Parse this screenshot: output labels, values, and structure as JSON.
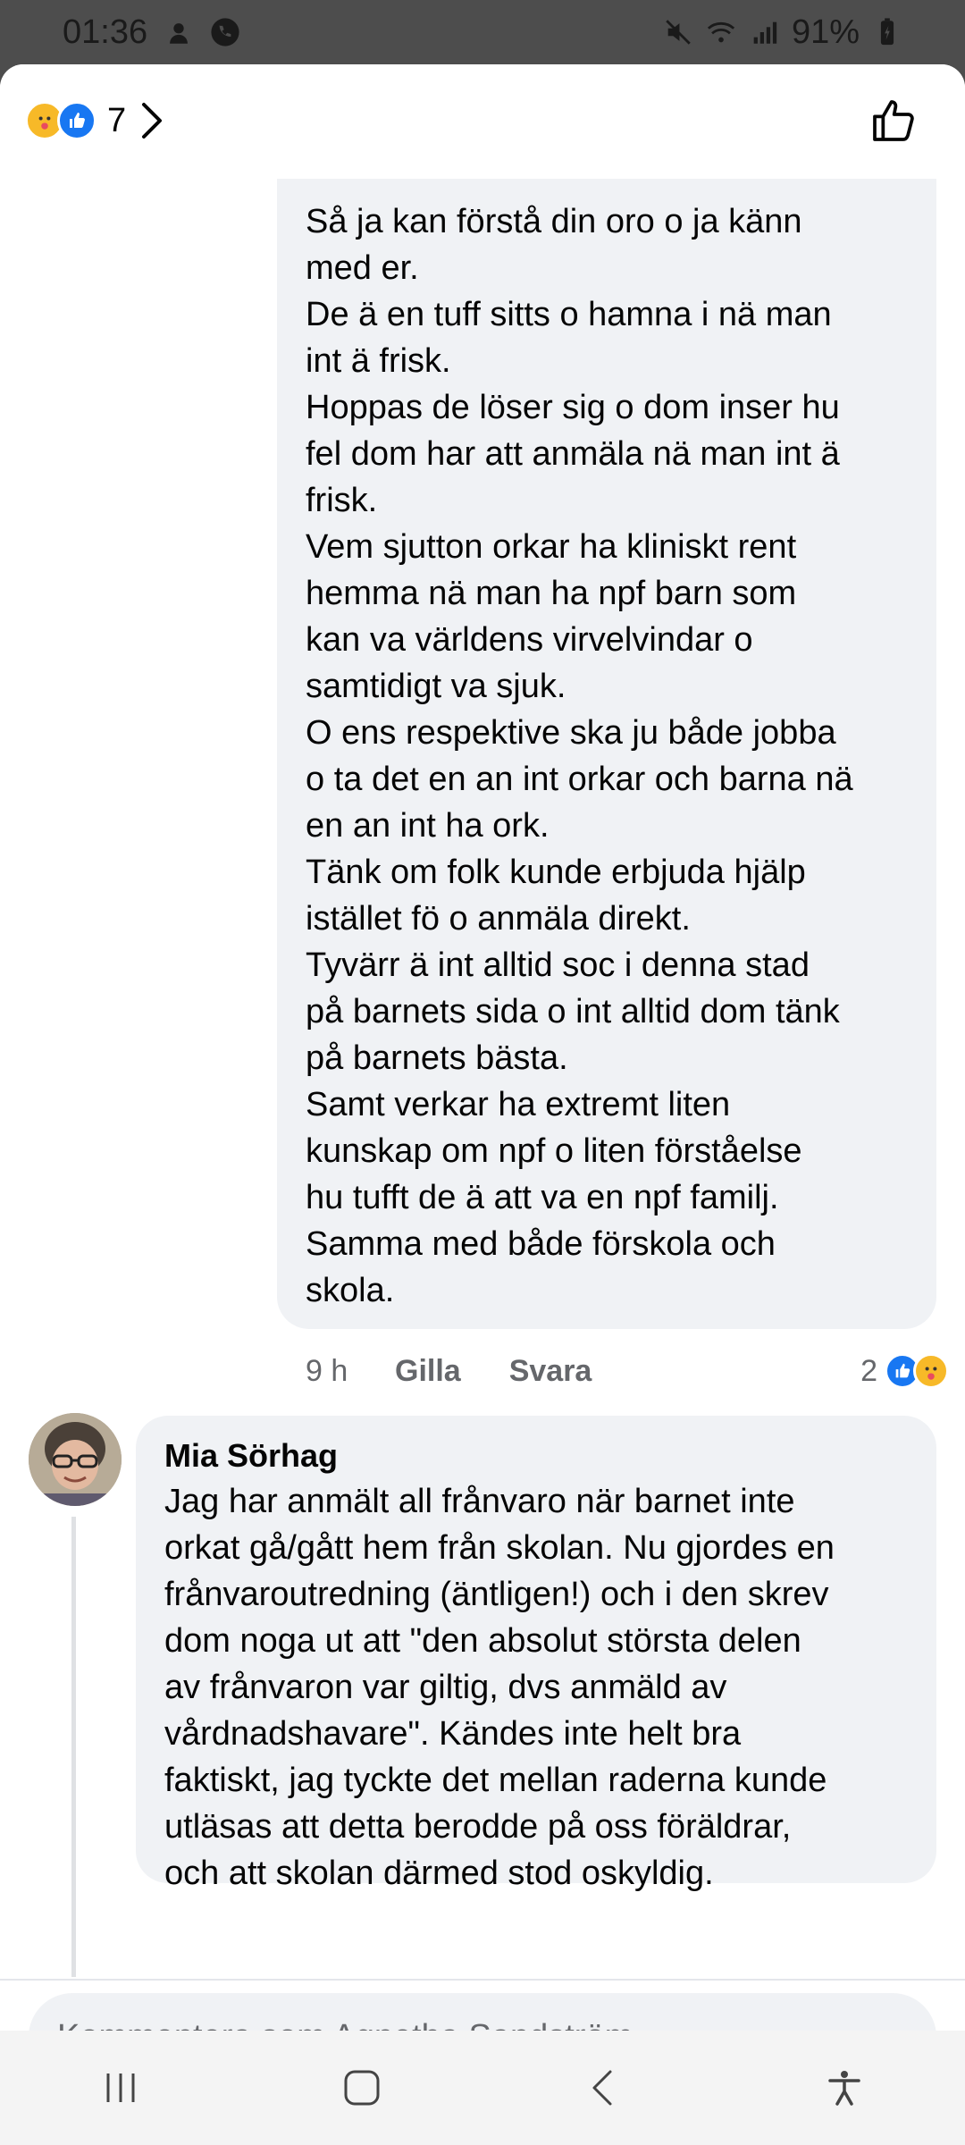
{
  "status_bar": {
    "time": "01:36",
    "battery": "91%"
  },
  "header": {
    "reaction_count": "7"
  },
  "comment1": {
    "lines": [
      "Så ja kan förstå din oro o ja känn",
      "med er.",
      "De ä en tuff sitts o hamna i nä man",
      "int ä frisk.",
      "Hoppas de löser sig o dom inser hu",
      "fel dom har att anmäla nä man int ä",
      "frisk.",
      "Vem sjutton orkar ha kliniskt rent",
      "hemma nä man ha npf barn som",
      "kan va världens virvelvindar o",
      "samtidigt va sjuk.",
      "O ens respektive ska ju både jobba",
      "o ta det en an int orkar och barna nä",
      "en an int ha ork.",
      "Tänk om folk kunde erbjuda hjälp",
      "istället fö o anmäla direkt.",
      "Tyvärr ä int alltid soc i denna stad",
      "på barnets sida o int alltid dom tänk",
      "på barnets bästa.",
      "Samt verkar ha extremt liten",
      "kunskap om npf o liten förståelse",
      "hu tufft de ä att va en npf familj.",
      "Samma med både förskola och",
      "skola."
    ],
    "time": "9 h",
    "like_label": "Gilla",
    "reply_label": "Svara",
    "reaction_count": "2"
  },
  "comment2": {
    "author": "Mia Sörhag",
    "lines": [
      "Jag har anmält all frånvaro när barnet inte",
      "orkat gå/gått hem från skolan. Nu gjordes en",
      "frånvaroutredning (äntligen!) och i den skrev",
      "dom noga ut att \"den absolut största delen",
      "av frånvaron var giltig, dvs anmäld av",
      "vårdnadshavare\". Kändes inte helt bra",
      "faktiskt, jag tyckte det mellan raderna kunde",
      "utläsas att detta berodde på oss föräldrar,",
      "och att skolan därmed stod oskyldig."
    ]
  },
  "composer": {
    "placeholder": "Kommentera som Agnetha Sandström"
  },
  "icons": {
    "reactions": [
      "care-reaction-icon",
      "like-reaction-icon"
    ],
    "header_right": "thumbs-up-outline-icon",
    "nav": [
      "recents-icon",
      "home-icon",
      "back-icon",
      "accessibility-icon"
    ]
  },
  "colors": {
    "accent": "#1877f2",
    "bubble": "#f0f2f5",
    "secondary_text": "#65676b"
  }
}
